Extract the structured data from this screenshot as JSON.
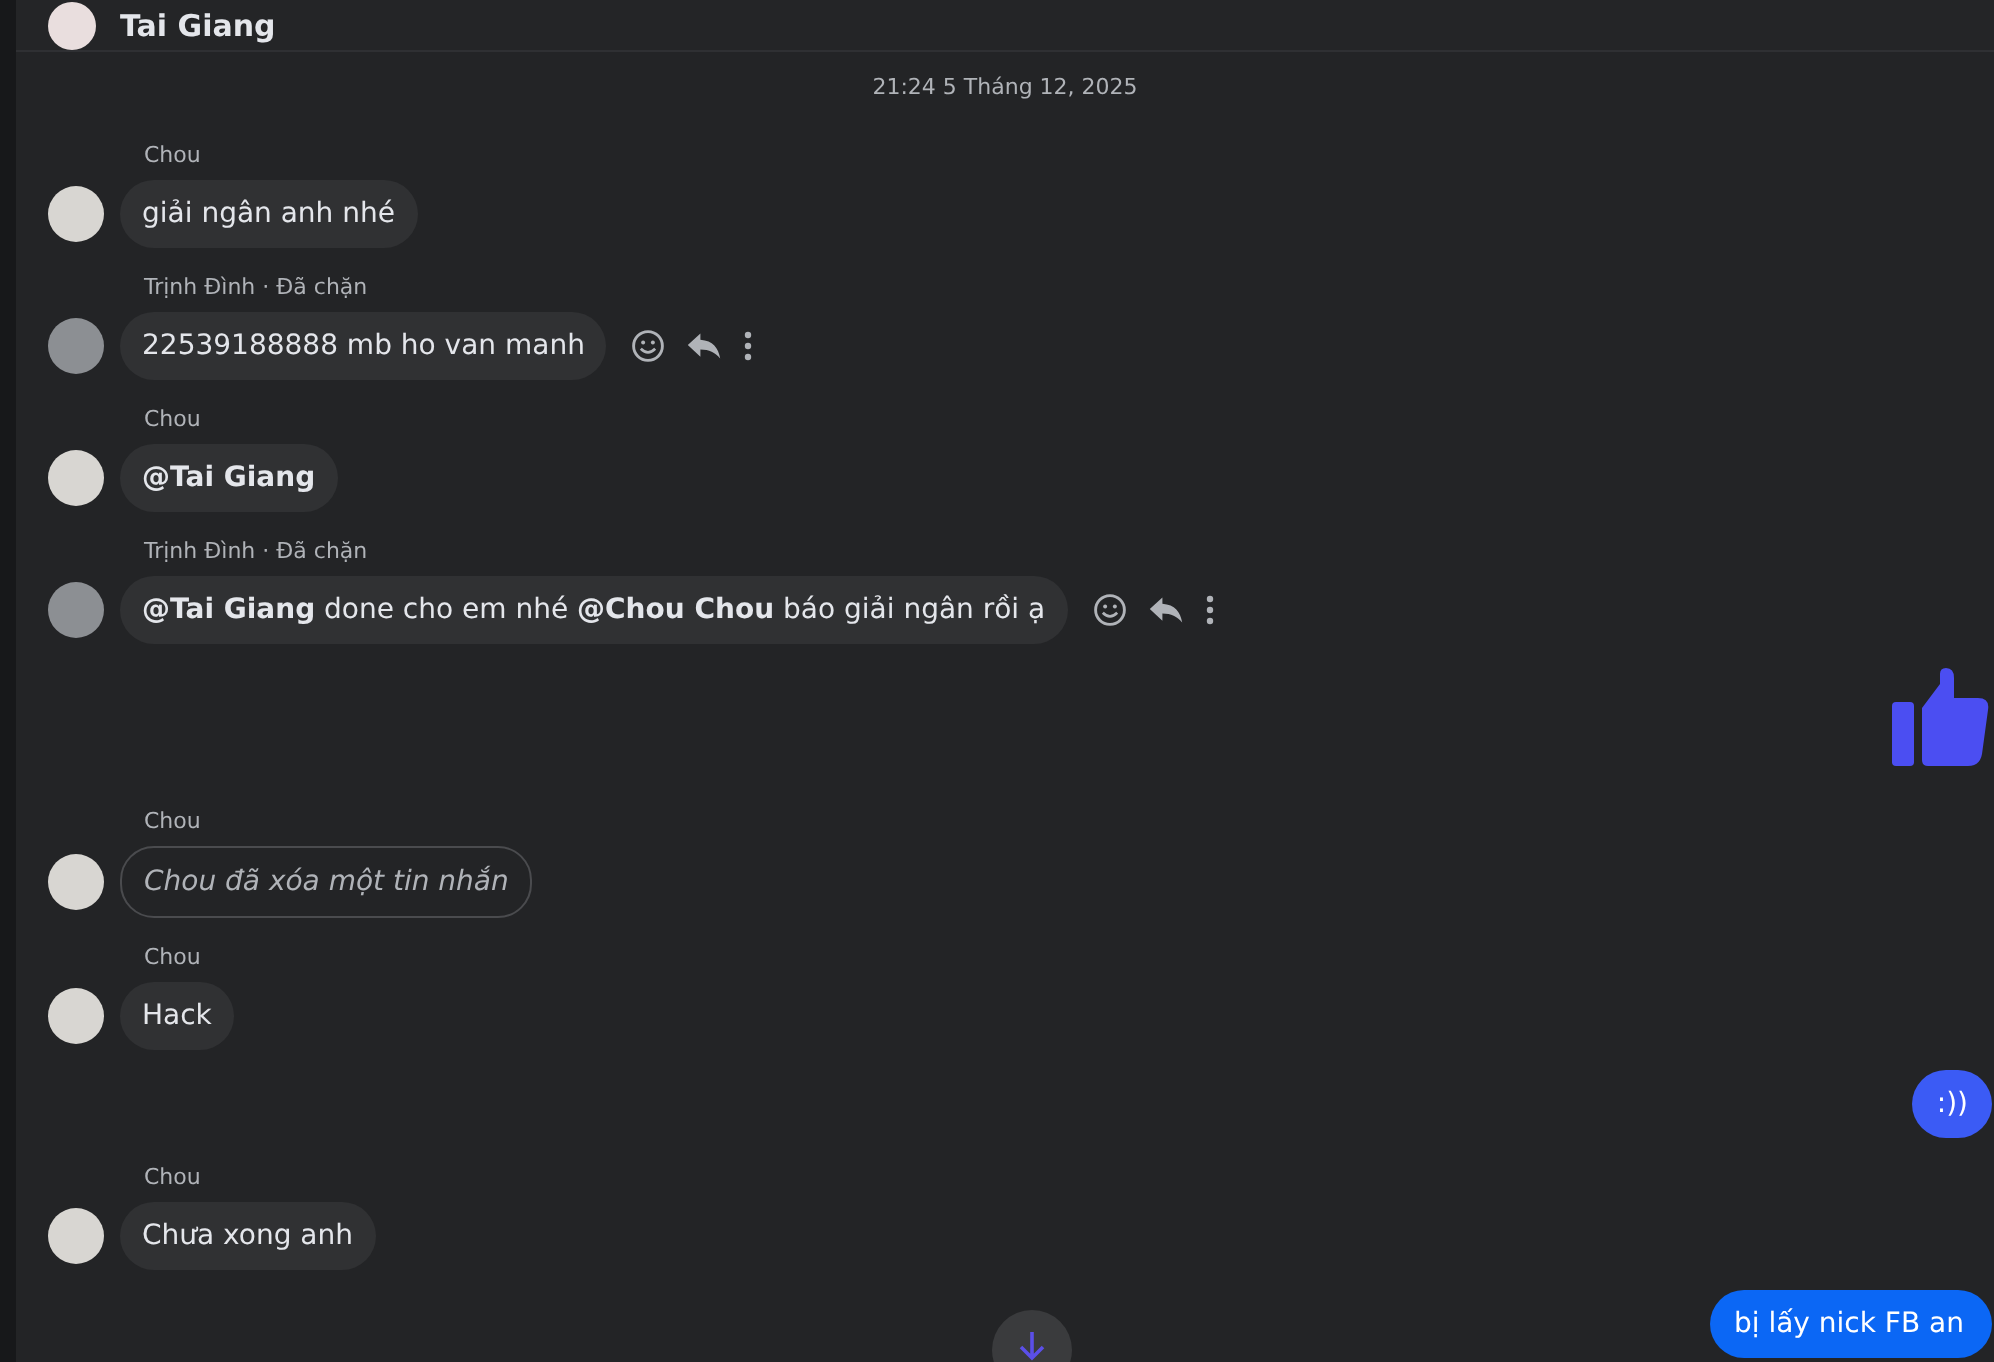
{
  "header": {
    "title": "Tai Giang"
  },
  "timestamp": "21:24 5 Tháng 12, 2025",
  "messages": [
    {
      "kind": "incoming",
      "sender": "Chou",
      "text": "giải ngân anh nhé",
      "bold": false,
      "actions": false
    },
    {
      "kind": "incoming",
      "sender": "Trịnh Đình · Đã chặn",
      "text": "22539188888 mb ho van manh",
      "bold": false,
      "actions": true
    },
    {
      "kind": "incoming",
      "sender": "Chou",
      "text": "@Tai Giang",
      "bold": true,
      "actions": false
    },
    {
      "kind": "incoming",
      "sender": "Trịnh Đình · Đã chặn",
      "text": "**@Tai Giang** done cho em nhé **@Chou Chou** báo giải ngân rồi ạ",
      "bold": false,
      "actions": true
    },
    {
      "kind": "like"
    },
    {
      "kind": "deleted",
      "sender": "Chou",
      "text": "Chou đã xóa một tin nhắn"
    },
    {
      "kind": "incoming",
      "sender": "Chou",
      "text": "Hack",
      "bold": false,
      "actions": false
    },
    {
      "kind": "outgoing",
      "text": ":))"
    },
    {
      "kind": "incoming",
      "sender": "Chou",
      "text": "Chưa xong anh",
      "bold": false,
      "actions": false
    },
    {
      "kind": "outgoing",
      "text": "bị lấy nick FB an"
    }
  ]
}
